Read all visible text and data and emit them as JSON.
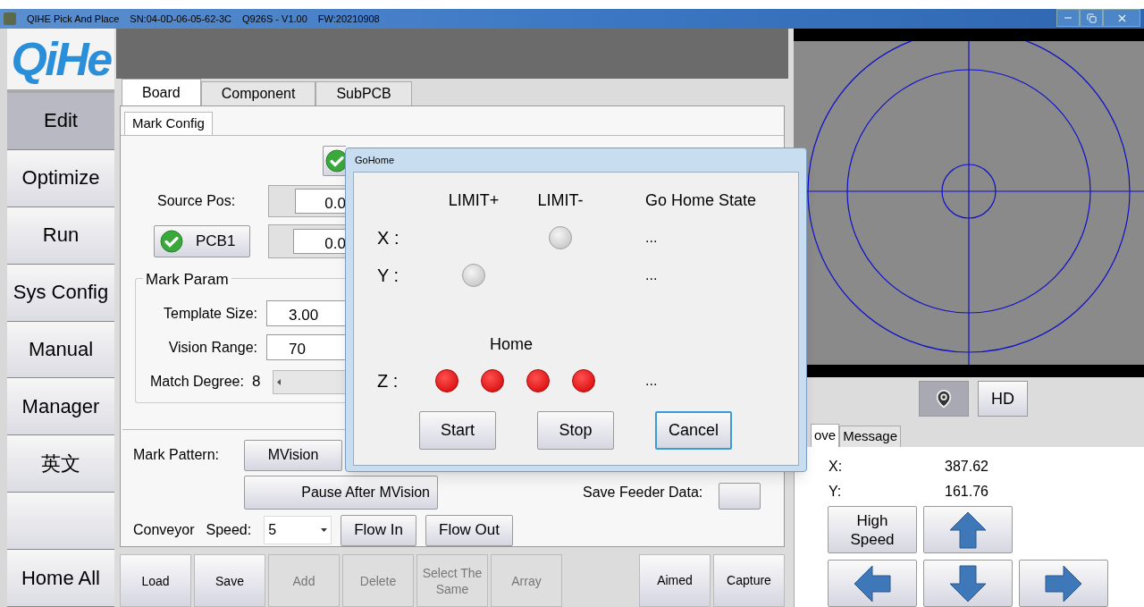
{
  "window": {
    "title_parts": [
      "QIHE Pick And Place",
      "SN:04-0D-06-05-62-3C",
      "Q926S - V1.00",
      "FW:20210908"
    ]
  },
  "logo": "QiHe",
  "sidebar": {
    "items": [
      {
        "label": "Edit",
        "selected": true
      },
      {
        "label": "Optimize",
        "selected": false
      },
      {
        "label": "Run",
        "selected": false
      },
      {
        "label": "Sys Config",
        "selected": false
      },
      {
        "label": "Manual",
        "selected": false
      },
      {
        "label": "Manager",
        "selected": false
      },
      {
        "label": "英文",
        "selected": false
      },
      {
        "selected": false
      },
      {
        "label": "Home All",
        "selected": false
      }
    ]
  },
  "tabs": [
    {
      "label": "Board",
      "selected": true
    },
    {
      "label": "Component",
      "selected": false
    },
    {
      "label": "SubPCB",
      "selected": false
    }
  ],
  "sub_tabs": [
    {
      "label": "Mark Config",
      "selected": true
    }
  ],
  "mark_config": {
    "source_pos": {
      "label": "Source Pos:",
      "value": "0.0"
    },
    "pcb": {
      "label": "PCB1",
      "value": "0.0"
    },
    "mark_param": {
      "title": "Mark Param",
      "template_size": {
        "label": "Template Size:",
        "value": "3.00"
      },
      "vision_range": {
        "label": "Vision Range:",
        "value": "70"
      },
      "match_degree": {
        "label": "Match Degree:",
        "value": "8"
      }
    }
  },
  "mark_pattern": {
    "label": "Mark Pattern:",
    "button": "MVision",
    "pause_button": "Pause After MVision"
  },
  "save_feeder": {
    "label": "Save Feeder Data:"
  },
  "conveyor": {
    "label": "Conveyor",
    "speed_label": "Speed:",
    "speed": "5",
    "buttons": [
      "Flow In",
      "Flow Out"
    ]
  },
  "toolbar": {
    "left": [
      {
        "label": "Load",
        "disabled": false
      },
      {
        "label": "Save",
        "disabled": false
      },
      {
        "label": "Add",
        "disabled": true
      },
      {
        "label": "Delete",
        "disabled": true
      },
      {
        "label": "Select The Same",
        "disabled": true
      },
      {
        "label": "Array",
        "disabled": true
      }
    ],
    "right": [
      {
        "label": "Aimed",
        "disabled": false
      },
      {
        "label": "Capture",
        "disabled": false
      }
    ]
  },
  "camera": {
    "buttons": [
      {
        "kind": "icon",
        "pressed": true
      },
      {
        "kind": "text",
        "label": "HD",
        "pressed": false
      }
    ]
  },
  "move_panel": {
    "tabs": [
      {
        "label": "ove",
        "selected": true
      },
      {
        "label": "Message",
        "selected": false
      }
    ],
    "x": {
      "label": "X:",
      "value": "387.62"
    },
    "y": {
      "label": "Y:",
      "value": "161.76"
    },
    "speed_button": "High Speed"
  },
  "dialog": {
    "title": "GoHome",
    "headers": [
      "LIMIT+",
      "LIMIT-",
      "Go Home State"
    ],
    "axes": [
      {
        "label": "X :",
        "limit_plus": {
          "shown": false
        },
        "limit_minus": {
          "shown": true,
          "lit": false
        },
        "state": "..."
      },
      {
        "label": "Y :",
        "limit_plus": {
          "shown": true,
          "lit": false
        },
        "limit_minus": {
          "shown": false
        },
        "state": "..."
      }
    ],
    "home_label": "Home",
    "z": {
      "label": "Z :",
      "home_lamps": [
        {
          "lit": true
        },
        {
          "lit": true
        },
        {
          "lit": true
        },
        {
          "lit": true
        }
      ],
      "state": "..."
    },
    "buttons": [
      {
        "label": "Start",
        "focused": false
      },
      {
        "label": "Stop",
        "focused": false
      },
      {
        "label": "Cancel",
        "focused": true
      }
    ]
  }
}
